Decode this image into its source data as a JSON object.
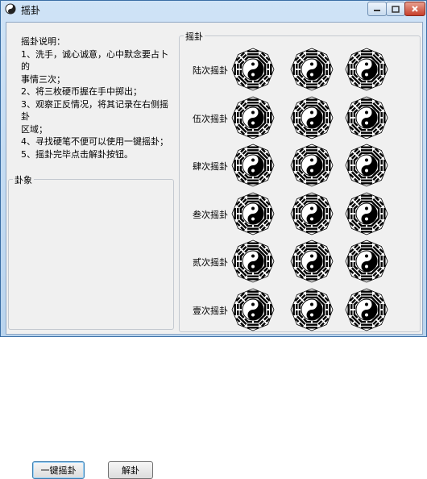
{
  "window": {
    "title": "摇卦"
  },
  "instructions": {
    "heading": "摇卦说明：",
    "lines": [
      "1、洗手，诚心诚意，心中默念要占卜的",
      "事情三次；",
      "2、将三枚硬币握在手中掷出；",
      "3、观察正反情况，将其记录在右侧摇卦",
      "区域；",
      "4、寻找硬笔不便可以使用一键摇卦；",
      "5、摇卦完毕点击解卦按钮。"
    ]
  },
  "hexagram_group": {
    "label": "卦象"
  },
  "toss_group": {
    "label": "摇卦"
  },
  "rows": [
    {
      "label": "陆次摇卦"
    },
    {
      "label": "伍次摇卦"
    },
    {
      "label": "肆次摇卦"
    },
    {
      "label": "叁次摇卦"
    },
    {
      "label": "贰次摇卦"
    },
    {
      "label": "壹次摇卦"
    }
  ],
  "buttons": {
    "one_click": "一键摇卦",
    "interpret": "解卦"
  },
  "icons": {
    "coin": "bagua-taiji-icon",
    "app": "app-icon"
  }
}
